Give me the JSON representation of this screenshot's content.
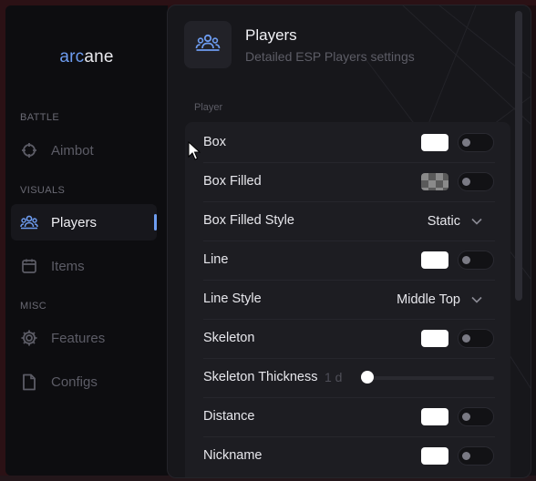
{
  "brand": {
    "part1": "arc",
    "part2": "ane"
  },
  "sidebar": {
    "sections": [
      "BATTLE",
      "VISUALS",
      "MISC"
    ],
    "items": [
      {
        "label": "Aimbot",
        "icon": "crosshair-icon",
        "active": false
      },
      {
        "label": "Players",
        "icon": "players-icon",
        "active": true
      },
      {
        "label": "Items",
        "icon": "items-icon",
        "active": false
      },
      {
        "label": "Features",
        "icon": "gear-icon",
        "active": false
      },
      {
        "label": "Configs",
        "icon": "file-icon",
        "active": false
      }
    ]
  },
  "header": {
    "title": "Players",
    "subtitle": "Detailed ESP Players settings",
    "icon": "players-icon"
  },
  "group": {
    "label": "Player"
  },
  "settings": [
    {
      "label": "Box",
      "type": "color-toggle",
      "color": "#ffffff",
      "enabled": false
    },
    {
      "label": "Box Filled",
      "type": "color-toggle",
      "color": "transparent",
      "enabled": false
    },
    {
      "label": "Box Filled Style",
      "type": "select",
      "value": "Static"
    },
    {
      "label": "Line",
      "type": "color-toggle",
      "color": "#ffffff",
      "enabled": false
    },
    {
      "label": "Line Style",
      "type": "select",
      "value": "Middle Top"
    },
    {
      "label": "Skeleton",
      "type": "color-toggle",
      "color": "#ffffff",
      "enabled": false
    },
    {
      "label": "Skeleton Thickness",
      "type": "slider",
      "value_text": "1 d"
    },
    {
      "label": "Distance",
      "type": "color-toggle",
      "color": "#ffffff",
      "enabled": false
    },
    {
      "label": "Nickname",
      "type": "color-toggle",
      "color": "#ffffff",
      "enabled": false
    }
  ],
  "colors": {
    "accent": "#6d9cf0",
    "panel": "#17171b",
    "card": "#1d1d22"
  }
}
